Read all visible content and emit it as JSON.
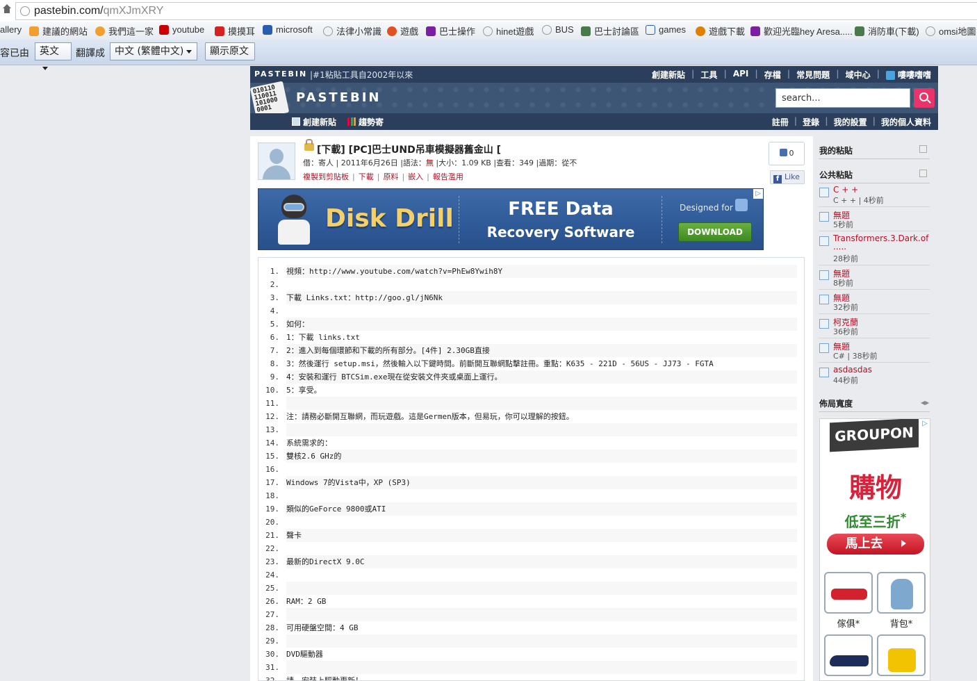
{
  "browser": {
    "url_host": "pastebin.com/",
    "url_path": "qmXJmXRY"
  },
  "bookmarks": [
    {
      "label": "allery",
      "color": ""
    },
    {
      "label": "建議的網站",
      "color": "#f0a030"
    },
    {
      "label": "我們這一家",
      "color": "#f0a030"
    },
    {
      "label": "youtube",
      "color": "#cc0000"
    },
    {
      "label": "摸摸耳",
      "color": "#d82020"
    },
    {
      "label": "microsoft",
      "color": "#2a5db0"
    },
    {
      "label": "法律小常識",
      "color": "#999999"
    },
    {
      "label": "遊戲",
      "color": "#e05020"
    },
    {
      "label": "巴士操作",
      "color": "#7b1fa2"
    },
    {
      "label": "hinet遊戲",
      "color": "#999999"
    },
    {
      "label": "BUS",
      "color": "#999999"
    },
    {
      "label": "巴士討論區",
      "color": "#4a7a4a"
    },
    {
      "label": "games",
      "color": "#2a5db0"
    },
    {
      "label": "遊戲下載",
      "color": "#e08000"
    },
    {
      "label": "歡迎光臨hey Aresa.....",
      "color": "#7b1fa2"
    },
    {
      "label": "消防車(下載)",
      "color": "#4a7a4a"
    },
    {
      "label": "omsi地圖",
      "color": "#999999"
    }
  ],
  "translate_bar": {
    "prefix": "容已由",
    "from_lang": "英文",
    "to_label": "翻譯成",
    "to_lang": "中文 (繁體中文)",
    "show_original": "顯示原文"
  },
  "pastebin": {
    "brand": "PASTEBIN",
    "tagline": "|#1粘貼工具自2002年以來",
    "top_nav": [
      "創建新貼",
      "工具",
      "API",
      "存檔",
      "常見問題",
      "域中心",
      "嘍嘍嗜嗜"
    ],
    "logo_bits": "010110 110011 101000 0001",
    "logo_text": "PASTEBIN",
    "search_placeholder": "search...",
    "sub_left": [
      "創建新貼",
      "趨勢寄"
    ],
    "sub_right": [
      "註冊",
      "登錄",
      "我的設置",
      "我的個人資料"
    ]
  },
  "paste": {
    "title": "[下載] [PC]巴士UND吊車模擬器舊金山 [",
    "meta": {
      "by": "借：寄人",
      "date": "2011年6月26日",
      "syntax_label": "語法：",
      "syntax_value": "無",
      "size": "大小：1.09 KB",
      "views": "查看：349",
      "expiry": "過期：從不"
    },
    "actions": [
      "複製到剪貼板",
      "下載",
      "原料",
      "嵌入",
      "報告濫用"
    ],
    "likes": "0",
    "like_label": "Like",
    "lines": [
      "視頻：http://www.youtube.com/watch?v=PhEw8Ywih8Y",
      "",
      "下載 Links.txt：http://goo.gl/jN6Nk",
      "",
      "如何：",
      "1：下載 links.txt",
      "2：進入到每個環節和下載的所有部分。[4件] 2.30GB直接",
      "3：然後運行 setup.msi，然後輸入以下鍵時間。前斷開互聯網點擊註冊。重點：K635 - 221D - 56US - JJ73 - FGTA",
      "4：安裝和運行 BTCSim.exe現在從安裝文件夾或桌面上運行。",
      "5：享受。",
      "",
      "注：請務必斷開互聯網，而玩遊戲。這是Germen版本，但易玩，你可以理解的按鈕。",
      "",
      "系統需求的：",
      "雙核2.6 GHz的",
      "",
      "Windows 7的Vista中，XP (SP3)",
      "",
      "類似的GeForce 9800或ATI",
      "",
      "聲卡",
      "",
      "最新的DirectX 9.0C",
      "",
      "",
      "RAM：2 GB",
      "",
      "可用硬盤空間：4 GB",
      "",
      "DVD驅動器",
      "",
      "請，安裝上驅動更新！"
    ]
  },
  "ad_banner": {
    "product": "Disk Drill",
    "headline": "FREE Data",
    "subline": "Recovery Software",
    "designed_for": "Designed for",
    "download": "DOWNLOAD"
  },
  "sidebar": {
    "my_pastes": "我的粘貼",
    "public_pastes": "公共粘貼",
    "items": [
      {
        "title": "C + +",
        "sub": "C + + | 4秒前"
      },
      {
        "title": "無題",
        "sub": "5秒前"
      },
      {
        "title": "Transformers.3.Dark.of",
        "title2": ".....",
        "sub": "28秒前"
      },
      {
        "title": "無題",
        "sub": "8秒前"
      },
      {
        "title": "無題",
        "sub": "32秒前"
      },
      {
        "title": "柯克蘭",
        "sub": "36秒前"
      },
      {
        "title": "無題",
        "sub": "C# | 38秒前"
      },
      {
        "title": "asdasdas",
        "sub": "44秒前"
      }
    ],
    "layout_width": "佈局寬度",
    "groupon": {
      "logo": "GROUPON",
      "buy": "購物",
      "low": "低至三折",
      "low_mark": "*",
      "go": "馬上去",
      "products": [
        "傢俱*",
        "背包*"
      ]
    }
  }
}
